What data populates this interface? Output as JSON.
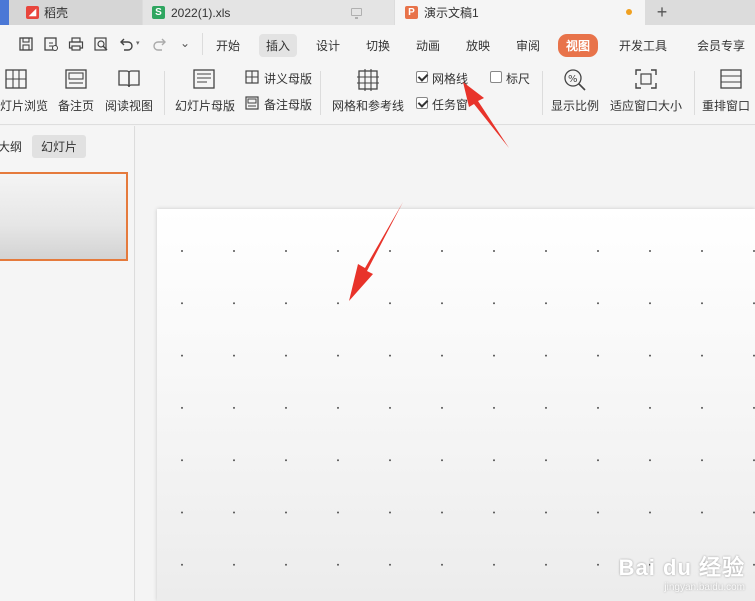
{
  "tabs": {
    "daoke": {
      "label": "稻壳",
      "icon": "daoke-logo-icon",
      "color": "#e8453c"
    },
    "xls": {
      "label": "2022(1).xls",
      "icon_letter": "S",
      "color": "#2fa660"
    },
    "ppt": {
      "label": "演示文稿1",
      "icon_letter": "P",
      "color": "#e8734a"
    },
    "add": "+"
  },
  "menu": {
    "items": [
      "开始",
      "插入",
      "设计",
      "切换",
      "动画",
      "放映",
      "审阅",
      "视图",
      "开发工具",
      "会员专享"
    ],
    "active": "视图",
    "active_color": "#e8734a"
  },
  "ribbon": {
    "slide_browse": "灯片浏览",
    "notes_page": "备注页",
    "reading_view": "阅读视图",
    "slide_master": "幻灯片母版",
    "handout_master": "讲义母版",
    "notes_master": "备注母版",
    "grid_and_guides": "网格和参考线",
    "gridlines": {
      "label": "网格线",
      "checked": true
    },
    "ruler": {
      "label": "标尺",
      "checked": false
    },
    "task_pane": {
      "label": "任务窗",
      "checked": true
    },
    "zoom": "显示比例",
    "fit_window": "适应窗口大小",
    "arrange_window": "重排窗口"
  },
  "left_panel": {
    "outline_tab": "大纲",
    "slides_tab": "幻灯片",
    "selection_color": "#e57a3c"
  },
  "watermark": {
    "main": "Bai du 经验",
    "sub": "jingyan.baidu.com"
  },
  "annotation_color": "#e8332a"
}
